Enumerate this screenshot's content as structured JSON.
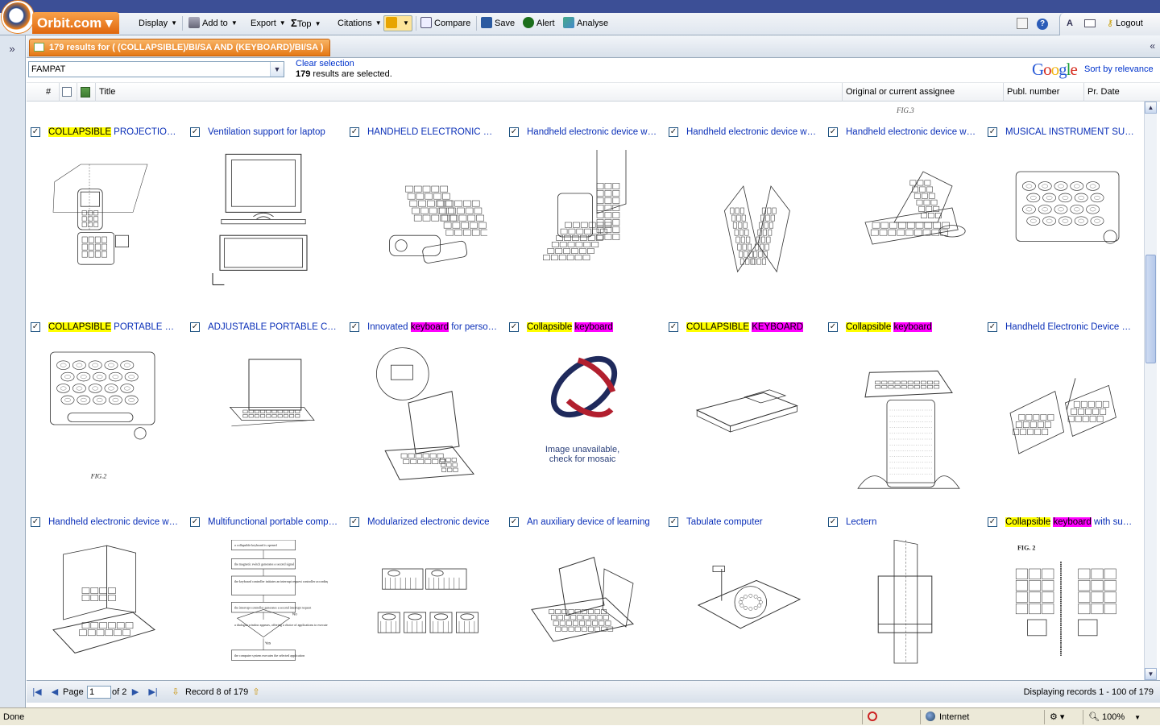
{
  "app": {
    "logo_text": "Orbit.com ▾"
  },
  "toolbar": {
    "display": "Display",
    "add_to": "Add to",
    "export": "Export",
    "top": "Top",
    "citations": "Citations",
    "compare": "Compare",
    "save": "Save",
    "alert": "Alert",
    "analyse": "Analyse",
    "logout": "Logout"
  },
  "results_tab": {
    "label": "179 results for ( (COLLAPSIBLE)/BI/SA AND (KEYBOARD)/BI/SA )"
  },
  "controls": {
    "collection": "FAMPAT",
    "clear_selection": "Clear selection",
    "selected_count": "179",
    "selected_suffix": " results are selected.",
    "google_logo": "Google",
    "sort_label": "Sort by relevance"
  },
  "columns": {
    "num": "#",
    "title": "Title",
    "assignee": "Original or current assignee",
    "publ": "Publ. number",
    "date": "Pr. Date"
  },
  "partial_fig_label": "FIG.3",
  "rows": [
    [
      {
        "parts": [
          [
            "COLLAPSIBLE",
            "y"
          ],
          [
            " PROJECTION DISPLAY DEVICE",
            ""
          ]
        ],
        "img": "phone"
      },
      {
        "parts": [
          [
            "Ventilation support for laptop",
            ""
          ]
        ],
        "img": "laptop"
      },
      {
        "parts": [
          [
            "HANDHELD ELECTRONIC DEVICE",
            ""
          ]
        ],
        "img": "exploded"
      },
      {
        "parts": [
          [
            "Handheld electronic device with keyboard",
            ""
          ]
        ],
        "img": "folding"
      },
      {
        "parts": [
          [
            "Handheld electronic device with keyboard",
            ""
          ]
        ],
        "img": "bifold"
      },
      {
        "parts": [
          [
            "Handheld electronic device with keyboard",
            ""
          ]
        ],
        "img": "stand"
      },
      {
        "parts": [
          [
            "MUSICAL INSTRUMENT SUPPORT",
            ""
          ]
        ],
        "img": "keypad"
      }
    ],
    [
      {
        "parts": [
          [
            "COLLAPSIBLE",
            "y"
          ],
          [
            " PORTABLE DISPLAY",
            ""
          ]
        ],
        "img": "keypad2",
        "fig": "FIG.2"
      },
      {
        "parts": [
          [
            "ADJUSTABLE PORTABLE COMPUTER",
            ""
          ]
        ],
        "img": "laptop2"
      },
      {
        "parts": [
          [
            "Innovated ",
            ""
          ],
          [
            "keyboard",
            "m"
          ],
          [
            " for personal computer",
            ""
          ]
        ],
        "img": "laptop3"
      },
      {
        "parts": [
          [
            "Collapsible",
            "y"
          ],
          [
            " ",
            ""
          ],
          [
            "keyboard",
            "m"
          ]
        ],
        "img": "na",
        "na_line1": "Image unavailable,",
        "na_line2": "check for mosaic"
      },
      {
        "parts": [
          [
            "COLLAPSIBLE",
            "y"
          ],
          [
            " ",
            ""
          ],
          [
            "KEYBOARD",
            "m"
          ]
        ],
        "img": "flat"
      },
      {
        "parts": [
          [
            "Collapsible",
            "y"
          ],
          [
            " ",
            ""
          ],
          [
            "keyboard",
            "m"
          ]
        ],
        "img": "lectern"
      },
      {
        "parts": [
          [
            "Handheld Electronic Device with keyboard",
            ""
          ]
        ],
        "img": "wings"
      }
    ],
    [
      {
        "parts": [
          [
            "Handheld electronic device with keyboard",
            ""
          ]
        ],
        "img": "frame"
      },
      {
        "parts": [
          [
            "Multifunctional portable computer",
            ""
          ]
        ],
        "img": "flow"
      },
      {
        "parts": [
          [
            "Modularized electronic device",
            ""
          ]
        ],
        "img": "modules"
      },
      {
        "parts": [
          [
            "An auxiliary device of learning",
            ""
          ]
        ],
        "img": "laptop4"
      },
      {
        "parts": [
          [
            "Tabulate computer",
            ""
          ]
        ],
        "img": "tablet"
      },
      {
        "parts": [
          [
            "Lectern",
            ""
          ]
        ],
        "img": "column"
      },
      {
        "parts": [
          [
            "Collapsible",
            "y"
          ],
          [
            " ",
            ""
          ],
          [
            "keyboard",
            "m"
          ],
          [
            " with support",
            ""
          ]
        ],
        "img": "fig2",
        "fig": "FIG. 2"
      }
    ]
  ],
  "flow_steps": [
    "a collapsible keyboard is opened",
    "the magnetic switch generates a second signal",
    "the keyboard controller initiates an interrupt request controller according to the second signal",
    "the interrupt controller generates a second interrupt request",
    "a dialogue window appears, offering a choice of applications to execute",
    "the computer system executes the selected application"
  ],
  "flow_yes": "Yes",
  "flow_no": "No",
  "pager": {
    "page_label": "Page",
    "page_value": "1",
    "of_pages": "of 2",
    "record": "Record 8 of 179",
    "displaying": "Displaying records 1 - 100 of 179"
  },
  "statusbar": {
    "left": "Done",
    "zone": "Internet",
    "zoom": "100%"
  }
}
